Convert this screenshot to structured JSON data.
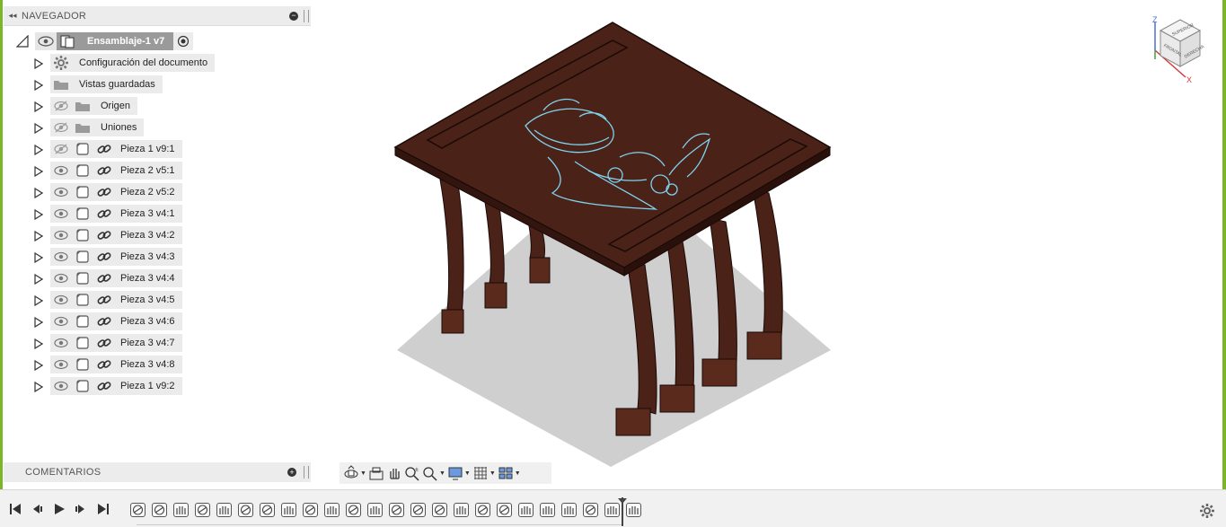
{
  "navigator": {
    "title": "NAVEGADOR",
    "root": {
      "label": "Ensamblaje-1 v7"
    },
    "items": [
      {
        "label": "Configuración del documento",
        "kind": "settings",
        "eye": "none"
      },
      {
        "label": "Vistas guardadas",
        "kind": "folder",
        "eye": "none"
      },
      {
        "label": "Origen",
        "kind": "folder",
        "eye": "hidden"
      },
      {
        "label": "Uniones",
        "kind": "folder",
        "eye": "hidden"
      },
      {
        "label": "Pieza 1 v9:1",
        "kind": "component",
        "eye": "hidden"
      },
      {
        "label": "Pieza 2 v5:1",
        "kind": "component",
        "eye": "visible"
      },
      {
        "label": "Pieza 2 v5:2",
        "kind": "component",
        "eye": "visible"
      },
      {
        "label": "Pieza 3 v4:1",
        "kind": "component",
        "eye": "visible"
      },
      {
        "label": "Pieza 3 v4:2",
        "kind": "component",
        "eye": "visible"
      },
      {
        "label": "Pieza 3 v4:3",
        "kind": "component",
        "eye": "visible"
      },
      {
        "label": "Pieza 3 v4:4",
        "kind": "component",
        "eye": "visible"
      },
      {
        "label": "Pieza 3 v4:5",
        "kind": "component",
        "eye": "visible"
      },
      {
        "label": "Pieza 3 v4:6",
        "kind": "component",
        "eye": "visible"
      },
      {
        "label": "Pieza 3 v4:7",
        "kind": "component",
        "eye": "visible"
      },
      {
        "label": "Pieza 3 v4:8",
        "kind": "component",
        "eye": "visible"
      },
      {
        "label": "Pieza 1 v9:2",
        "kind": "component",
        "eye": "visible"
      }
    ]
  },
  "comments": {
    "title": "COMENTARIOS"
  },
  "viewcube": {
    "top_label": "SUPERIOR",
    "front_label": "FRONTAL",
    "right_label": "DERECHA",
    "axis_z": "Z",
    "axis_x": "X"
  },
  "navbar": {
    "tools": [
      "orbit-icon",
      "look-at-icon",
      "pan-icon",
      "zoom-icon",
      "fit-icon",
      "display-icon",
      "grid-icon",
      "viewports-icon"
    ]
  },
  "timeline": {
    "features": [
      "joint",
      "joint",
      "rigid",
      "joint",
      "rigid",
      "joint",
      "joint",
      "rigid",
      "joint",
      "rigid",
      "joint",
      "rigid",
      "joint",
      "joint",
      "joint",
      "rigid",
      "joint",
      "joint",
      "rigid",
      "rigid",
      "rigid",
      "joint",
      "rigid",
      "rigid"
    ]
  },
  "colors": {
    "accent_green": "#7ab52a",
    "wood": "#4a2218",
    "engraving": "#7fd4f0",
    "shadow": "#cfcfcf"
  }
}
